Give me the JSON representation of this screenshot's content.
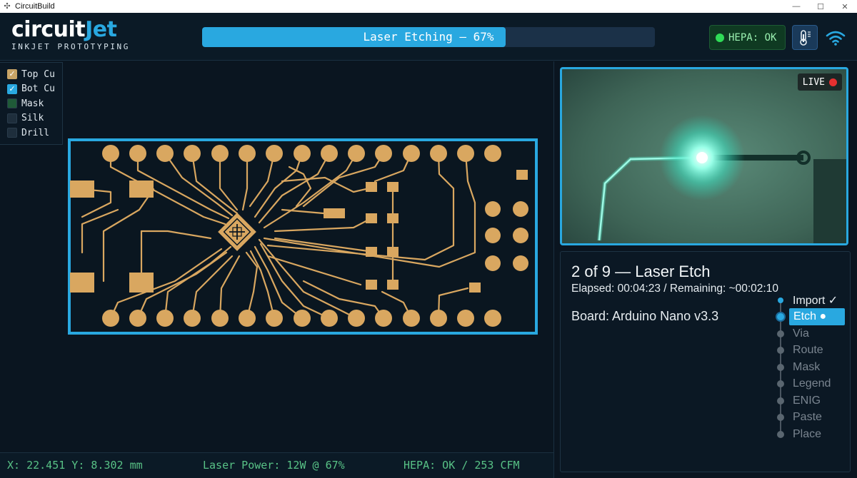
{
  "window": {
    "title": "CircuitBuild"
  },
  "header": {
    "logo_main_a": "circuit",
    "logo_main_b": "Jet",
    "logo_sub": "INKJET PROTOTYPING",
    "progress_label": "Laser Etching — 67%",
    "progress_fraction": 0.67,
    "hepa_badge": "HEPA: OK",
    "thermo_icon": "thermometer-icon",
    "wifi_icon": "wifi-icon"
  },
  "layers": [
    {
      "label": "Top Cu",
      "checked": true,
      "color": "#c8a466"
    },
    {
      "label": "Bot Cu",
      "checked": true,
      "color": "#29a8e0"
    },
    {
      "label": "Mask",
      "checked": false,
      "color": "#1f5a38"
    },
    {
      "label": "Silk",
      "checked": false,
      "color": "#1e2e3c"
    },
    {
      "label": "Drill",
      "checked": false,
      "color": "#1e2e3c"
    }
  ],
  "camera": {
    "live_label": "LIVE"
  },
  "job": {
    "title": "2 of 9 — Laser Etch",
    "elapsed": "Elapsed: 00:04:23 / Remaining: ~00:02:10",
    "board": "Board: Arduino Nano v3.3",
    "steps": [
      {
        "label": "Import ✓",
        "state": "done"
      },
      {
        "label": "Etch ●",
        "state": "active"
      },
      {
        "label": "Via",
        "state": "pending"
      },
      {
        "label": "Route",
        "state": "pending"
      },
      {
        "label": "Mask",
        "state": "pending"
      },
      {
        "label": "Legend",
        "state": "pending"
      },
      {
        "label": "ENIG",
        "state": "pending"
      },
      {
        "label": "Paste",
        "state": "pending"
      },
      {
        "label": "Place",
        "state": "pending"
      }
    ]
  },
  "status": {
    "coords": "X: 22.451 Y: 8.302 mm",
    "laser": "Laser Power: 12W @ 67%",
    "hepa": "HEPA: OK / 253 CFM"
  },
  "colors": {
    "accent": "#29a8e0",
    "copper": "#d9a760",
    "ok_green": "#2fdc57",
    "status_text": "#58c286"
  }
}
